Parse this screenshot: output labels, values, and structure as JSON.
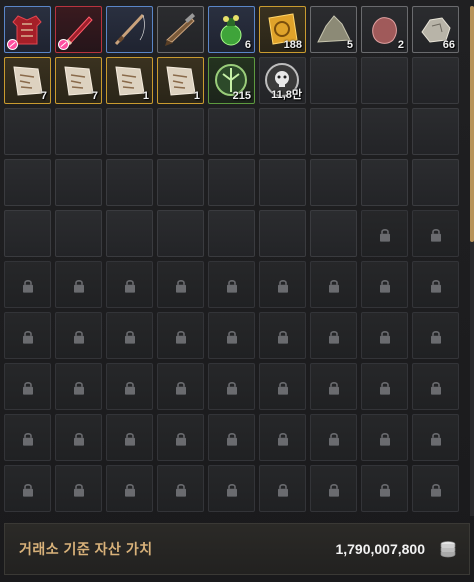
{
  "inventory": {
    "filled_slots": [
      {
        "name": "red-armor-item",
        "rarity": "blue",
        "icon": "armor-icon",
        "restricted": true,
        "qty": ""
      },
      {
        "name": "red-blade-item",
        "rarity": "red",
        "icon": "blade-icon",
        "restricted": true,
        "qty": ""
      },
      {
        "name": "fishing-rod-item",
        "rarity": "blue",
        "icon": "fishing-rod-icon",
        "restricted": false,
        "qty": ""
      },
      {
        "name": "musket-item",
        "rarity": "white",
        "icon": "musket-icon",
        "restricted": false,
        "qty": ""
      },
      {
        "name": "green-potion-item",
        "rarity": "blue",
        "icon": "potion-icon",
        "restricted": false,
        "qty": "6"
      },
      {
        "name": "gold-scroll-item",
        "rarity": "gold",
        "icon": "scroll-icon",
        "restricted": false,
        "qty": "188"
      },
      {
        "name": "stone-shard-item",
        "rarity": "white",
        "icon": "shard-icon",
        "restricted": false,
        "qty": "5"
      },
      {
        "name": "red-ore-item",
        "rarity": "white",
        "icon": "ore-icon",
        "restricted": false,
        "qty": "2"
      },
      {
        "name": "silver-ore-item",
        "rarity": "white",
        "icon": "rock-icon",
        "restricted": false,
        "qty": "66"
      },
      {
        "name": "map-paper-item-1",
        "rarity": "gold",
        "icon": "map-icon",
        "restricted": false,
        "qty": "7"
      },
      {
        "name": "map-paper-item-2",
        "rarity": "gold",
        "icon": "map-icon",
        "restricted": false,
        "qty": "7"
      },
      {
        "name": "map-paper-item-3",
        "rarity": "gold",
        "icon": "map-icon",
        "restricted": false,
        "qty": "1"
      },
      {
        "name": "map-paper-item-4",
        "rarity": "gold",
        "icon": "map-icon",
        "restricted": false,
        "qty": "1"
      },
      {
        "name": "green-emblem-item",
        "rarity": "green",
        "icon": "emblem-icon",
        "restricted": false,
        "qty": "215"
      },
      {
        "name": "skull-coin-item",
        "rarity": "none",
        "icon": "skull-coin-icon",
        "restricted": false,
        "qty": "11,8만"
      }
    ],
    "total_slots": 90,
    "unlocked_slots": 43
  },
  "footer": {
    "label": "거래소 기준 자산 가치",
    "value": "1,790,007,800",
    "icon": "silver-coins-icon"
  },
  "colors": {
    "accent": "#d9b27a",
    "rarity_blue": "#5a86c8",
    "rarity_red": "#b8333f",
    "rarity_gold": "#c99b2f",
    "rarity_green": "#5d9a3f"
  }
}
